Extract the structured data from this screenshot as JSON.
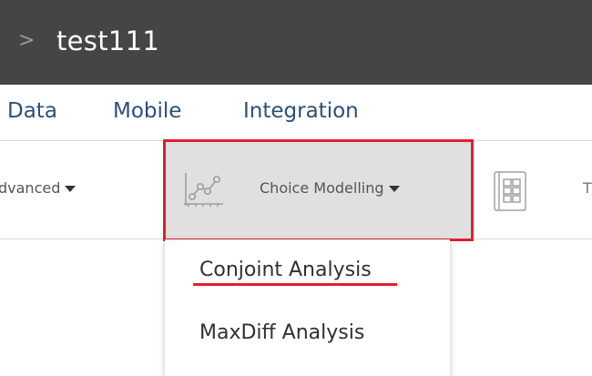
{
  "header": {
    "chevron": ">",
    "project_title": "test111"
  },
  "nav": {
    "items": [
      "Data",
      "Mobile",
      "Integration"
    ]
  },
  "toolbar": {
    "advanced_label": "dvanced",
    "choice_modelling_label": "Choice Modelling",
    "cut_label": "T"
  },
  "dropdown": {
    "items": [
      "Conjoint Analysis",
      "MaxDiff Analysis"
    ]
  },
  "colors": {
    "topbar": "#454545",
    "nav_text": "#2b4f7a",
    "highlight_red": "#e21e2e",
    "selected_bg": "#e0e0e0"
  },
  "icons": {
    "chevron": "chevron-right-icon",
    "choice_modelling": "scatter-chart-icon",
    "table": "table-document-icon"
  }
}
